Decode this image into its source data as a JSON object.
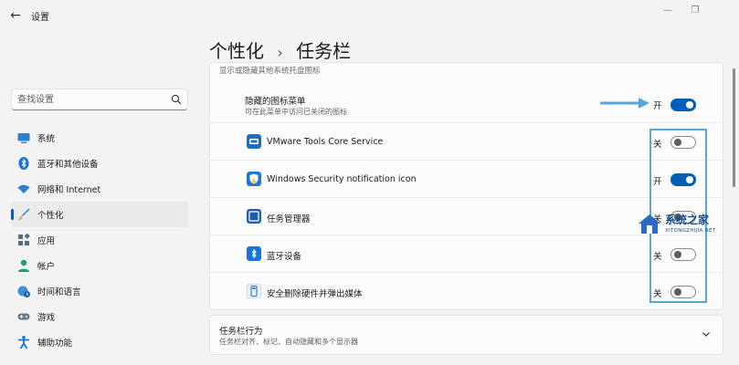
{
  "app": {
    "back_glyph": "←",
    "title": "设置"
  },
  "window": {
    "minimize": "—",
    "maximize": "❐"
  },
  "search": {
    "placeholder": "查找设置"
  },
  "sidebar": {
    "items": [
      {
        "label": "系统",
        "icon": "display-icon"
      },
      {
        "label": "蓝牙和其他设备",
        "icon": "bluetooth-icon"
      },
      {
        "label": "网络和 Internet",
        "icon": "wifi-icon"
      },
      {
        "label": "个性化",
        "icon": "brush-icon",
        "active": true
      },
      {
        "label": "应用",
        "icon": "apps-icon"
      },
      {
        "label": "帐户",
        "icon": "account-icon"
      },
      {
        "label": "时间和语言",
        "icon": "globe-clock-icon"
      },
      {
        "label": "游戏",
        "icon": "gamepad-icon"
      },
      {
        "label": "辅助功能",
        "icon": "accessibility-icon"
      }
    ]
  },
  "page": {
    "breadcrumb_parent": "个性化",
    "breadcrumb_sep": "›",
    "breadcrumb_current": "任务栏"
  },
  "section": {
    "cut_text": "显示或隐藏其他系统托盘图标",
    "hidden_menu": {
      "title": "隐藏的图标菜单",
      "subtitle": "可在此菜单中访问已关闭的图标",
      "state": "开",
      "on": true
    },
    "apps": [
      {
        "label": "VMware Tools Core Service",
        "state": "关",
        "on": false,
        "icon": "vmware-icon"
      },
      {
        "label": "Windows Security notification icon",
        "state": "开",
        "on": true,
        "icon": "windows-security-icon"
      },
      {
        "label": "任务管理器",
        "state": "关",
        "on": false,
        "icon": "task-manager-icon"
      },
      {
        "label": "蓝牙设备",
        "state": "关",
        "on": false,
        "icon": "bluetooth-device-icon"
      },
      {
        "label": "安全删除硬件并弹出媒体",
        "state": "关",
        "on": false,
        "icon": "usb-eject-icon"
      }
    ]
  },
  "taskbar_behaviors": {
    "title": "任务栏行为",
    "subtitle": "任务栏对齐、标记、自动隐藏和多个显示器"
  },
  "watermark": {
    "name": "系统之家",
    "url": "XITONGZHIJIA.NET"
  },
  "colors": {
    "accent": "#005fb8",
    "annotation": "#58a6d6",
    "background": "#f3f3f3",
    "card": "#fbfbfb"
  }
}
